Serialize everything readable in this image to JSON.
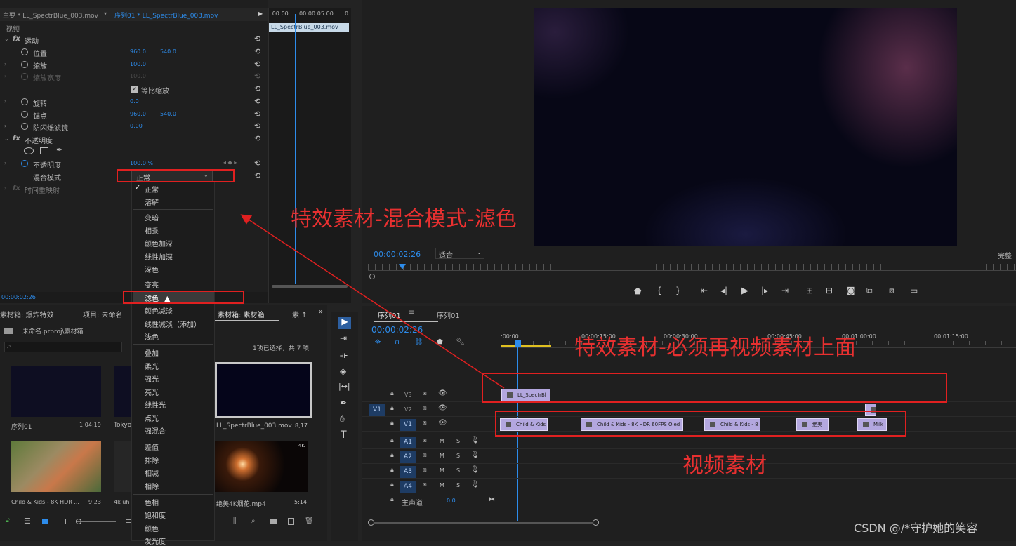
{
  "effect_controls": {
    "tab_source": "主要 * LL_SpectrBlue_003.mov",
    "tab_sequence": "序列01 * LL_SpectrBlue_003.mov",
    "section_video": "视频",
    "motion": "运动",
    "position": {
      "label": "位置",
      "x": "960.0",
      "y": "540.0"
    },
    "scale": {
      "label": "缩放",
      "value": "100.0"
    },
    "scale_width": {
      "label": "缩放宽度",
      "value": "100.0"
    },
    "uniform_scale": "等比缩放",
    "rotation": {
      "label": "旋转",
      "value": "0.0"
    },
    "anchor": {
      "label": "锚点",
      "x": "960.0",
      "y": "540.0"
    },
    "antiflicker": {
      "label": "防闪烁滤镜",
      "value": "0.00"
    },
    "opacity_section": "不透明度",
    "opacity": {
      "label": "不透明度",
      "value": "100.0 %"
    },
    "blend_mode": {
      "label": "混合模式",
      "value": "正常"
    },
    "time_remap": "时间重映射",
    "timecode": "00:00:02:26",
    "mini_timeline": {
      "start": ":00:00",
      "mark": "00:00:05:00",
      "end": "0",
      "clip": "LL_SpectrBlue_003.mov"
    }
  },
  "blend_menu": {
    "groups": [
      [
        "正常",
        "溶解"
      ],
      [
        "变暗",
        "相乘",
        "颜色加深",
        "线性加深",
        "深色"
      ],
      [
        "变亮",
        "滤色",
        "颜色减淡",
        "线性减淡（添加）",
        "浅色"
      ],
      [
        "叠加",
        "柔光",
        "强光",
        "亮光",
        "线性光",
        "点光",
        "强混合"
      ],
      [
        "差值",
        "排除",
        "相减",
        "相除"
      ],
      [
        "色相",
        "饱和度",
        "颜色",
        "发光度"
      ]
    ],
    "checked": "正常",
    "highlighted": "滤色"
  },
  "project": {
    "tab1": "素材箱: 爆炸特效",
    "tab2": "项目: 未命名",
    "tab3": "素材箱: 素材箱",
    "tab4": "素 ↑",
    "path": "未命名.prproj\\素材箱",
    "selection": "1项已选择，共 7 项",
    "items": [
      {
        "name": "序列01",
        "duration": "1:04:19"
      },
      {
        "name": "Tokyo",
        "duration": ""
      },
      {
        "name": "LL_SpectrBlue_003.mov",
        "duration": "8;17"
      },
      {
        "name": "Child & Kids - 8K HDR ...",
        "duration": "9:23"
      },
      {
        "name": "4k uh",
        "duration": ""
      },
      {
        "name": "绝美4K烟花.mp4",
        "duration": "5:14"
      }
    ],
    "badge_4k": "4K"
  },
  "program": {
    "timecode": "00:00:02:26",
    "fit": "适合",
    "quality": "完整"
  },
  "timeline": {
    "tab1": "序列01",
    "tab2": "序列01",
    "timecode": "00:00:02:26",
    "ruler": [
      ":00:00",
      "00:00:15:00",
      "00:00:30:00",
      "00:00:45:00",
      "00:01:00:00",
      "00:01:15:00"
    ],
    "video_tracks": [
      "V3",
      "V2",
      "V1"
    ],
    "audio_tracks": [
      "A1",
      "A2",
      "A3",
      "A4"
    ],
    "source_v": "V1",
    "master": "主声道",
    "master_value": "0.0",
    "v3_clip": "LL_SpectrBl",
    "v1_clips": [
      "Child & Kids",
      "Child & Kids - 8K HDR 60FPS Oled",
      "Child & Kids - 8",
      "绝美",
      "Milk"
    ]
  },
  "annotations": {
    "blend": "特效素材-混合模式-滤色",
    "above": "特效素材-必须再视频素材上面",
    "video": "视频素材"
  },
  "watermark": "CSDN @/*守护她的笑容",
  "colors": {
    "accent": "#2d8ceb",
    "annotation": "#e02020",
    "clip": "#b3a7df",
    "track": "#1e3c64"
  }
}
